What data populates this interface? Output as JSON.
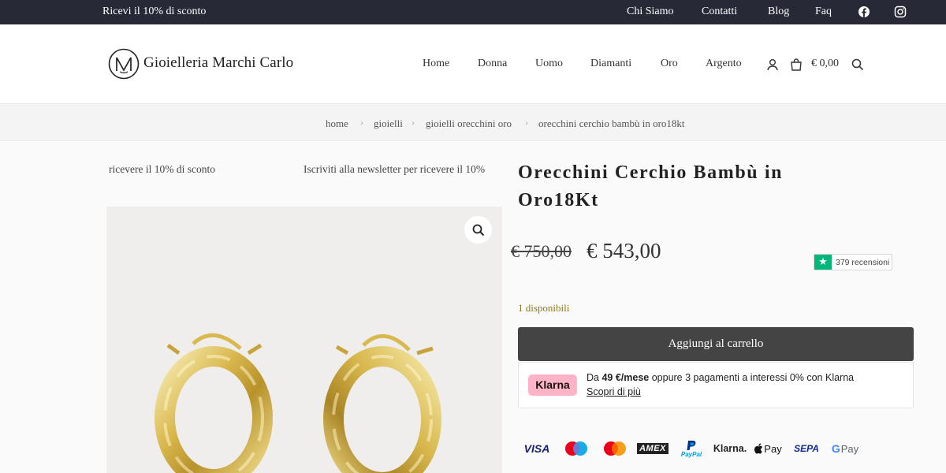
{
  "topbar": {
    "promo": "Ricevi il 10% di sconto",
    "links": [
      "Chi Siamo",
      "Contatti",
      "Blog",
      "Faq"
    ],
    "social_icons": [
      "facebook-icon",
      "instagram-icon"
    ]
  },
  "header": {
    "logo_text": "Gioielleria Marchi Carlo",
    "nav": [
      "Home",
      "Donna",
      "Uomo",
      "Diamanti",
      "Oro",
      "Argento"
    ],
    "cart_total": "€ 0,00"
  },
  "breadcrumb": [
    "home",
    "gioielli",
    "gioielli orecchini oro",
    "orecchini cerchio bambù in oro18kt"
  ],
  "ticker": {
    "left": "ricevere il 10% di sconto",
    "right": "Iscriviti alla newsletter per ricevere il 10%"
  },
  "product": {
    "title": "Orecchini Cerchio Bambù in Oro18Kt",
    "price_old": "€ 750,00",
    "price_new": "€ 543,00",
    "reviews": "379 recensioni",
    "stock": "1 disponibili",
    "add_to_cart": "Aggiungi al carrello"
  },
  "klarna": {
    "badge": "Klarna",
    "text_prefix": "Da ",
    "amount": "49 €/mese",
    "text_suffix": " oppure 3 pagamenti a interessi 0% con Klarna",
    "link": "Scopri di più"
  },
  "payments": {
    "visa": "VISA",
    "amex": "AMEX",
    "paypal": "PayPal",
    "klarna": "Klarna.",
    "applepay": "Pay",
    "sepa": "SEPA",
    "gpay": "Pay"
  },
  "colors": {
    "topbar": "#272a36",
    "button": "#444444",
    "stock": "#8a7a1c",
    "trustpilot": "#00b67a",
    "klarna_pink": "#ffb3c7"
  }
}
